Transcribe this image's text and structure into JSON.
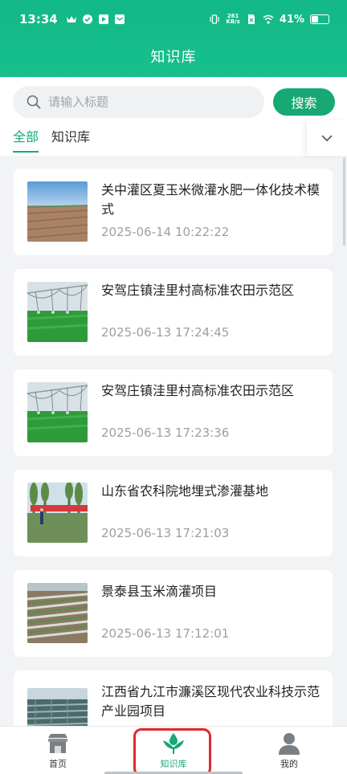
{
  "status_bar": {
    "time": "13:34",
    "net_speed_value": "261",
    "net_speed_unit": "KB/s",
    "battery": "41%",
    "battery_level": 0.41
  },
  "header": {
    "title": "知识库"
  },
  "search": {
    "placeholder": "请输入标题",
    "button_label": "搜索"
  },
  "tabs": [
    {
      "label": "全部",
      "active": true
    },
    {
      "label": "知识库",
      "active": false
    }
  ],
  "articles": [
    {
      "title": "关中灌区夏玉米微灌水肥一体化技术模式",
      "date": "2025-06-14 10:22:22",
      "image": "field-dry-soil"
    },
    {
      "title": "安驾庄镇洼里村高标准农田示范区",
      "date": "2025-06-13 17:24:45",
      "image": "center-pivot-irrigation"
    },
    {
      "title": "安驾庄镇洼里村高标准农田示范区",
      "date": "2025-06-13 17:23:36",
      "image": "center-pivot-irrigation"
    },
    {
      "title": "山东省农科院地埋式渗灌基地",
      "date": "2025-06-13 17:21:03",
      "image": "field-banner-trees"
    },
    {
      "title": "景泰县玉米滴灌项目",
      "date": "2025-06-13 17:12:01",
      "image": "drip-irrigation-rows"
    },
    {
      "title": "江西省九江市濂溪区现代农业科技示范产业园项目",
      "date": "",
      "image": "greenhouse-park"
    }
  ],
  "tabbar": {
    "items": [
      {
        "label": "首页",
        "icon": "store-icon",
        "active": false
      },
      {
        "label": "知识库",
        "icon": "sprout-icon",
        "active": true
      },
      {
        "label": "我的",
        "icon": "person-icon",
        "active": false
      }
    ]
  },
  "colors": {
    "brand": "#16a974",
    "header": "#17c08d",
    "highlight": "#e0282e"
  }
}
